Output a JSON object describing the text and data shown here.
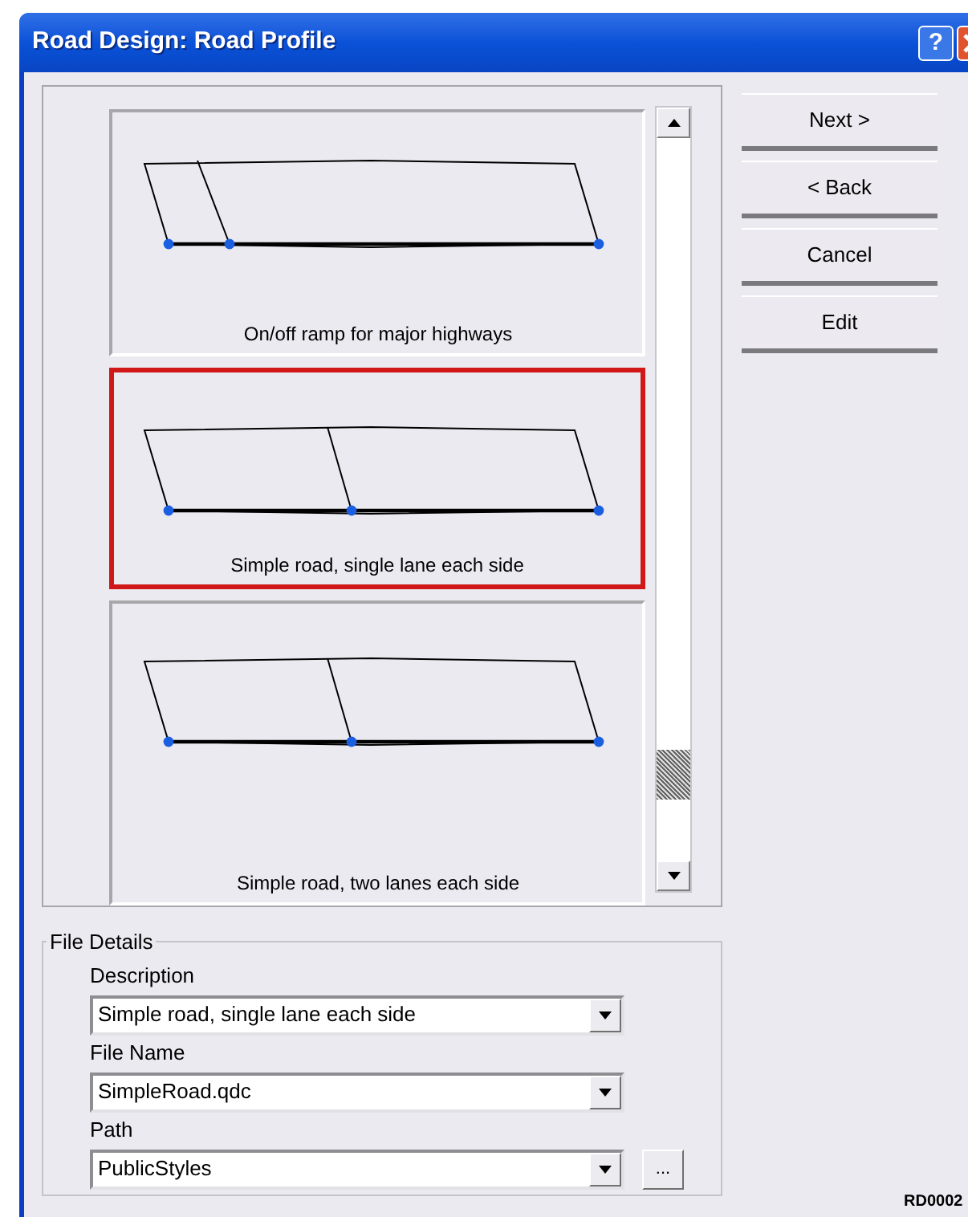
{
  "window": {
    "title": "Road Design: Road Profile",
    "help": "?"
  },
  "styles": [
    {
      "caption": "On/off ramp for major highways",
      "kind": "ramp",
      "selected": false
    },
    {
      "caption": "Simple road, single lane each side",
      "kind": "simple",
      "selected": true
    },
    {
      "caption": "Simple road, two lanes each side",
      "kind": "simple",
      "selected": false
    }
  ],
  "buttons": [
    "Next >",
    "< Back",
    "Cancel",
    "Edit"
  ],
  "file_details": {
    "title": "File Details",
    "fields": [
      {
        "label": "Description",
        "value": "Simple road, single lane each side"
      },
      {
        "label": "File Name",
        "value": "SimpleRoad.qdc"
      },
      {
        "label": "Path",
        "value": "PublicStyles"
      }
    ],
    "browse": "..."
  },
  "code": "RD0002"
}
